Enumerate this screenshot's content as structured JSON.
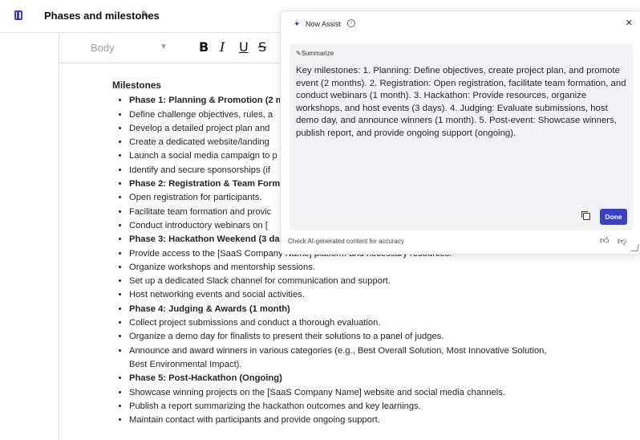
{
  "header": {
    "title": "Phases and milestones"
  },
  "toolbar": {
    "style_value": "Body",
    "bold": "B",
    "italic": "I",
    "underline": "U",
    "strike": "S"
  },
  "doc": {
    "heading": "Milestones",
    "items": [
      {
        "text": "Phase 1: Planning & Promotion (2 m",
        "phase": true
      },
      {
        "text": "Define challenge objectives, rules, a",
        "phase": false
      },
      {
        "text": "Develop a detailed project plan and",
        "phase": false
      },
      {
        "text": "Create a dedicated website/landing",
        "phase": false
      },
      {
        "text": "Launch a social media campaign to p",
        "phase": false
      },
      {
        "text": "Identify and secure sponsorships (if",
        "phase": false
      },
      {
        "text": "Phase 2: Registration & Team Forma",
        "phase": true
      },
      {
        "text": "Open registration for participants.",
        "phase": false
      },
      {
        "text": "Facilitate team formation and provic",
        "phase": false
      },
      {
        "text": "Conduct introductory webinars on [",
        "phase": false
      },
      {
        "text": "Phase 3: Hackathon Weekend (3 da",
        "phase": true
      },
      {
        "text": "Provide access to the [SaaS Company Name] platform and necessary resources.",
        "phase": false
      },
      {
        "text": "Organize workshops and mentorship sessions.",
        "phase": false
      },
      {
        "text": "Set up a dedicated Slack channel for communication and support.",
        "phase": false
      },
      {
        "text": "Host networking events and social activities.",
        "phase": false
      },
      {
        "text": "Phase 4: Judging & Awards (1 month)",
        "phase": true
      },
      {
        "text": "Collect project submissions and conduct a thorough evaluation.",
        "phase": false
      },
      {
        "text": "Organize a demo day for finalists to present their solutions to a panel of judges.",
        "phase": false
      },
      {
        "text": "Announce and award winners in various categories (e.g., Best Overall Solution, Most Innovative Solution, Best Environmental Impact).",
        "phase": false
      },
      {
        "text": "Phase 5: Post-Hackathon (Ongoing)",
        "phase": true
      },
      {
        "text": "Showcase winning projects on the [SaaS Company Name] website and social media channels.",
        "phase": false
      },
      {
        "text": "Publish a report summarizing the hackathon outcomes and key learnings.",
        "phase": false
      },
      {
        "text": "Maintain contact with participants and provide ongoing support.",
        "phase": false
      }
    ]
  },
  "assist": {
    "title": "Now Assist",
    "action_label": "Summarize",
    "summary": "Key milestones: 1. Planning: Define objectives, create project plan, and promote event (2 months). 2. Registration: Open registration, facilitate team formation, and conduct webinars (1 month). 3. Hackathon: Provide resources, organize workshops, and host events (3 days). 4. Judging: Evaluate submissions, host demo day, and announce winners (1 month). 5. Post-event: Showcase winners, publish report, and provide ongoing support (ongoing).",
    "done_label": "Done",
    "disclaimer": "Check AI-generated content for accuracy",
    "accent_color": "#3b41c5"
  }
}
